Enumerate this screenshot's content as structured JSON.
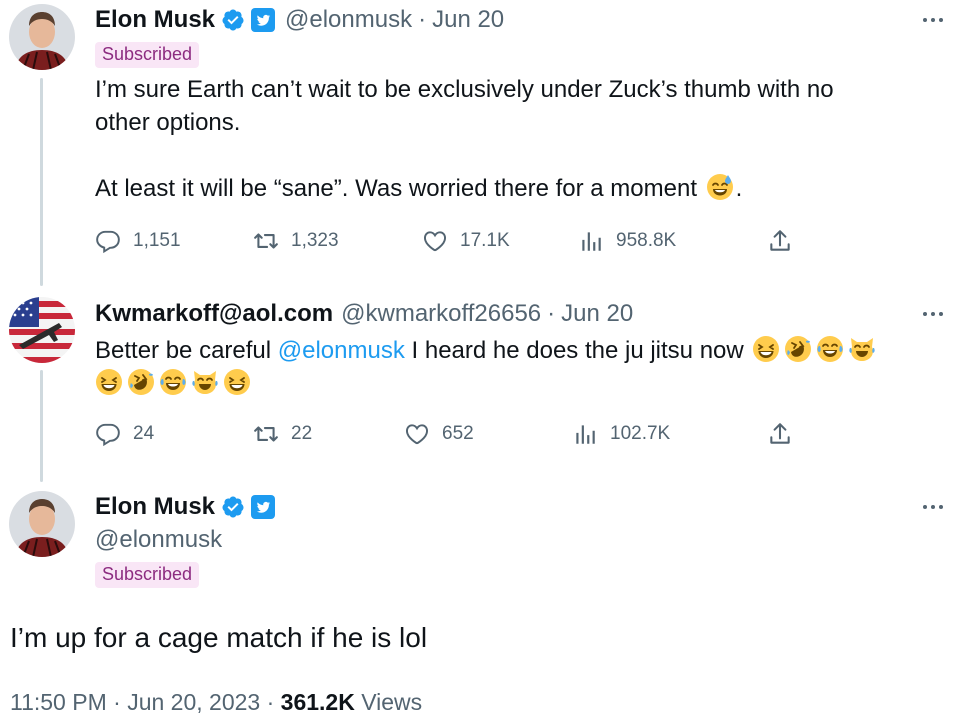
{
  "tweet1": {
    "name": "Elon Musk",
    "handle": "@elonmusk",
    "separator": "·",
    "date": "Jun 20",
    "subscribed": "Subscribed",
    "text_line1": "I’m sure Earth can’t wait to be exclusively under Zuck’s thumb with no",
    "text_line2": "other options.",
    "text_line3": "At least it will be “sane”. Was worried there for a moment",
    "text_end": ".",
    "emoji": "sweat-smile-emoji",
    "replies": "1,151",
    "retweets": "1,323",
    "likes": "17.1K",
    "views": "958.8K"
  },
  "tweet2": {
    "name": "Kwmarkoff@aol.com",
    "handle": "@kwmarkoff26656",
    "separator": "·",
    "date": "Jun 20",
    "text_before": "Better be careful ",
    "mention": "@elonmusk",
    "text_after": " I heard he does the ju jitsu now",
    "replies": "24",
    "retweets": "22",
    "likes": "652",
    "views": "102.7K"
  },
  "tweet3": {
    "name": "Elon Musk",
    "handle": "@elonmusk",
    "subscribed": "Subscribed",
    "text": "I’m up for a cage match if he is lol",
    "time": "11:50 PM",
    "separator": "·",
    "date": "Jun 20, 2023",
    "views_count": "361.2K",
    "views_label": "Views"
  },
  "colors": {
    "accent": "#1d9bf0",
    "subscribed_bg": "#f9e6f6",
    "subscribed_text": "#8c2c80",
    "secondary": "#536471",
    "thread_line": "#cfd9de"
  },
  "icons": [
    "verified-badge-icon",
    "twitter-bird-icon",
    "reply-icon",
    "retweet-icon",
    "like-icon",
    "views-icon",
    "share-icon",
    "more-icon"
  ]
}
